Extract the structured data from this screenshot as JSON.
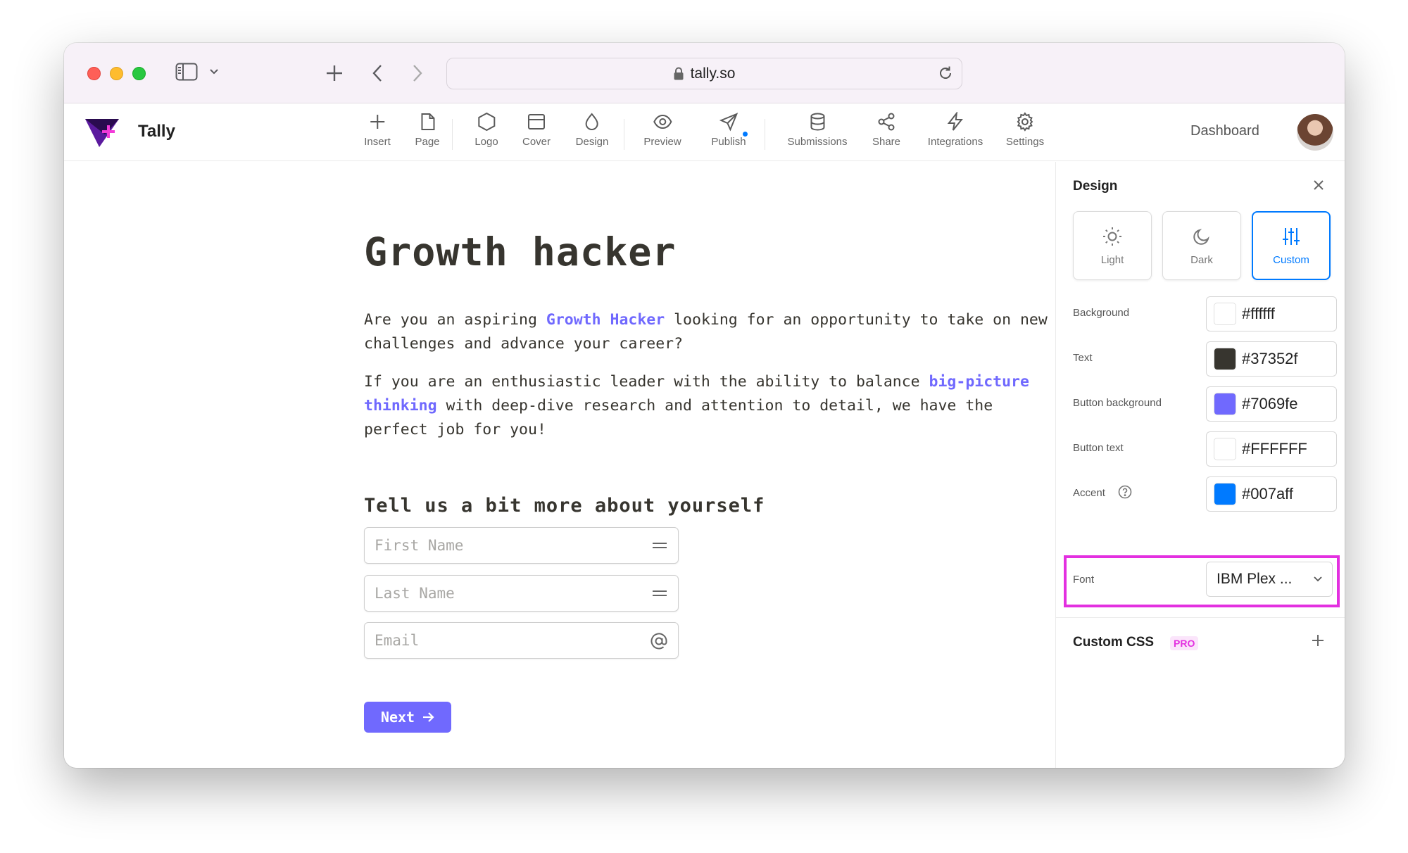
{
  "browser": {
    "url": "tally.so"
  },
  "app": {
    "brand": "Tally",
    "toolbar": [
      {
        "key": "insert",
        "label": "Insert"
      },
      {
        "key": "page",
        "label": "Page"
      },
      {
        "key": "logo",
        "label": "Logo"
      },
      {
        "key": "cover",
        "label": "Cover"
      },
      {
        "key": "design",
        "label": "Design"
      },
      {
        "key": "preview",
        "label": "Preview"
      },
      {
        "key": "publish",
        "label": "Publish"
      },
      {
        "key": "submissions",
        "label": "Submissions"
      },
      {
        "key": "share",
        "label": "Share"
      },
      {
        "key": "integrations",
        "label": "Integrations"
      },
      {
        "key": "settings",
        "label": "Settings"
      }
    ],
    "dashboard_label": "Dashboard"
  },
  "form": {
    "title": "Growth hacker",
    "para1": {
      "before": "Are you an aspiring ",
      "highlight": "Growth Hacker",
      "after": " looking for an opportunity to take on new challenges and advance your career?"
    },
    "para2": {
      "before": "If you are an enthusiastic leader with the ability to balance ",
      "highlight": "big-picture thinking",
      "after": " with deep-dive research and attention to detail, we have the perfect job for you!"
    },
    "section_title": "Tell us a bit more about yourself",
    "fields": [
      {
        "placeholder": "First Name",
        "icon": "short-text-icon"
      },
      {
        "placeholder": "Last Name",
        "icon": "short-text-icon"
      },
      {
        "placeholder": "Email",
        "icon": "at-sign-icon"
      }
    ],
    "next_label": "Next"
  },
  "design_panel": {
    "title": "Design",
    "themes": [
      {
        "label": "Light",
        "icon": "sun-icon",
        "active": false
      },
      {
        "label": "Dark",
        "icon": "moon-icon",
        "active": false
      },
      {
        "label": "Custom",
        "icon": "sliders-icon",
        "active": true
      }
    ],
    "colors": [
      {
        "label": "Background",
        "value": "#ffffff",
        "swatch": "#ffffff"
      },
      {
        "label": "Text",
        "value": "#37352f",
        "swatch": "#37352f"
      },
      {
        "label": "Button background",
        "value": "#7069fe",
        "swatch": "#7069fe"
      },
      {
        "label": "Button text",
        "value": "#FFFFFF",
        "swatch": "#FFFFFF"
      },
      {
        "label": "Accent",
        "value": "#007aff",
        "swatch": "#007aff"
      }
    ],
    "font": {
      "label": "Font",
      "value": "IBM Plex ..."
    },
    "custom_css": {
      "label": "Custom CSS",
      "badge": "PRO"
    }
  },
  "accent_colors": {
    "highlight_outline": "#e330e0",
    "active_theme": "#007aff"
  }
}
